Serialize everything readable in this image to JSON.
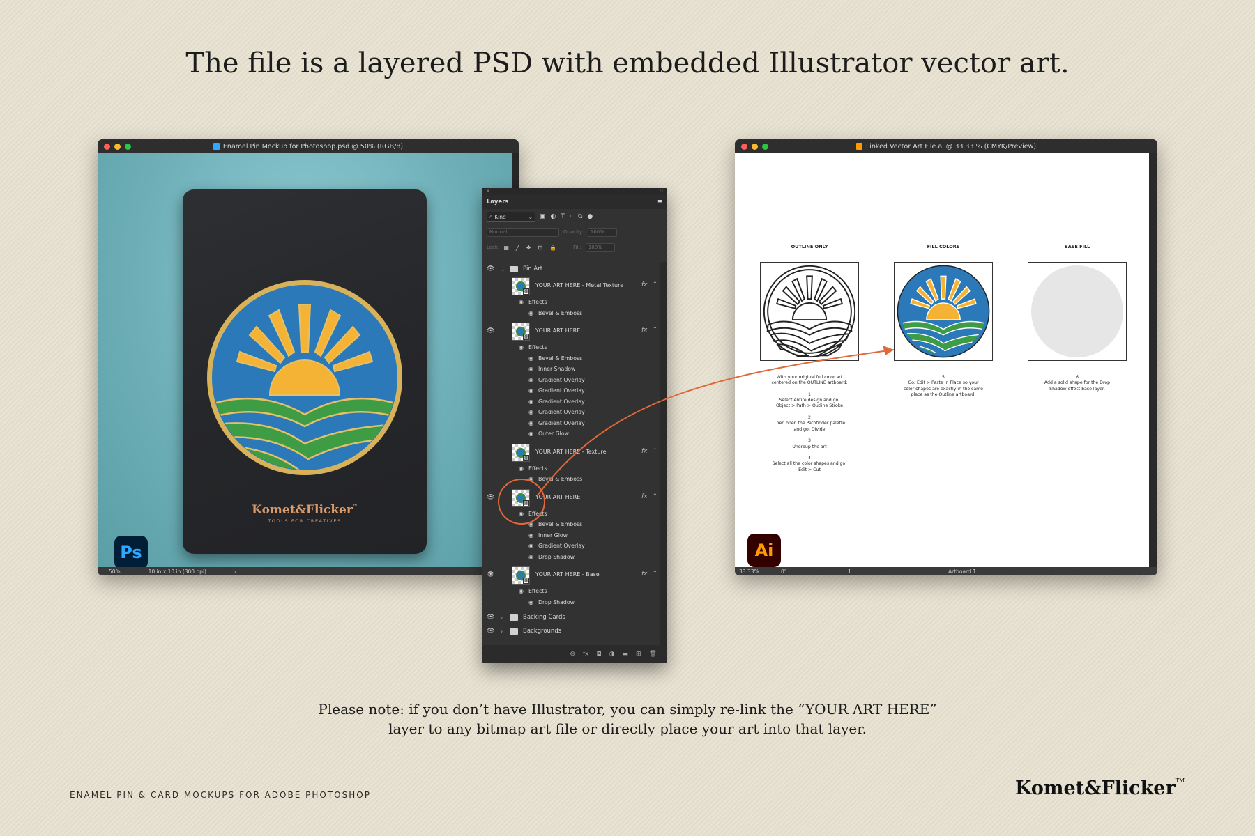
{
  "headline": "The file is a layered PSD with embedded Illustrator vector art.",
  "note": {
    "line1": "Please note: if you don’t have Illustrator, you can simply re-link the “YOUR ART HERE”",
    "line2": "layer to any bitmap art file or directly place your art into that layer."
  },
  "footer": {
    "left": "ENAMEL PIN & CARD MOCKUPS FOR ADOBE PHOTOSHOP",
    "brand": "Komet&Flicker",
    "brand_tm": "TM"
  },
  "colors": {
    "ps_blue": "#31a8ff",
    "ai_orange": "#ff9a00",
    "pin_blue": "#2b79b8",
    "pin_yellow": "#f5b335",
    "pin_green": "#3e9c45",
    "pin_gold": "#d8b25a",
    "annotation": "#e0683a"
  },
  "photoshop": {
    "title": "Enamel Pin Mockup for Photoshop.psd @ 50% (RGB/8)",
    "zoom": "50%",
    "doc_size": "10 in x 10 in (300 ppi)",
    "status_caret": "›",
    "badge": "Ps",
    "card": {
      "brand": "Komet&Flicker",
      "brand_tm": "™",
      "tagline": "TOOLS FOR CREATIVES"
    }
  },
  "layers_panel": {
    "close_glyph": "×",
    "collapse_glyph": "‹‹",
    "tab": "Layers",
    "menu_glyph": "≡",
    "kind_label": "Kind",
    "filter_icons": [
      "▣",
      "◐",
      "T",
      "⌗",
      "⧉",
      "●"
    ],
    "blend_mode": "Normal",
    "opacity_label": "Opacity:",
    "opacity_value": "100%",
    "lock_label": "Lock:",
    "lock_icons": [
      "▦",
      "╱",
      "✥",
      "⊡",
      "🔒"
    ],
    "fill_label": "Fill:",
    "fill_value": "100%",
    "eye_glyph": "👁",
    "effect_eye_glyph": "◉",
    "fx_label": "fx",
    "group_pin_art": "Pin Art",
    "layers": [
      {
        "name": "YOUR ART HERE - Metal Texture",
        "effects_label": "Effects",
        "effects": [
          "Bevel & Emboss"
        ],
        "visible": false
      },
      {
        "name": "YOUR ART HERE",
        "effects_label": "Effects",
        "effects": [
          "Bevel & Emboss",
          "Inner Shadow",
          "Gradient Overlay",
          "Gradient Overlay",
          "Gradient Overlay",
          "Gradient Overlay",
          "Gradient Overlay",
          "Outer Glow"
        ],
        "visible": true
      },
      {
        "name": "YOUR ART HERE - Texture",
        "effects_label": "Effects",
        "effects": [
          "Bevel & Emboss"
        ],
        "visible": false
      },
      {
        "name": "YOUR ART HERE",
        "effects_label": "Effects",
        "effects": [
          "Bevel & Emboss",
          "Inner Glow",
          "Gradient Overlay",
          "Drop Shadow"
        ],
        "visible": true
      },
      {
        "name": "YOUR ART HERE - Base",
        "effects_label": "Effects",
        "effects": [
          "Drop Shadow"
        ],
        "visible": true
      }
    ],
    "group_backing_cards": "Backing Cards",
    "group_backgrounds": "Backgrounds",
    "bottom_icons": [
      "⊖",
      "fx",
      "◘",
      "◑",
      "▬",
      "⊞",
      "🗑"
    ]
  },
  "illustrator": {
    "title": "Linked Vector Art File.ai @ 33.33 % (CMYK/Preview)",
    "badge": "Ai",
    "zoom": "33.33%",
    "rotation": "0°",
    "page_nav": "1",
    "artboard_name": "Artboard 1",
    "artboards": [
      {
        "label": "OUTLINE ONLY",
        "text": "With your original full color art\ncentered on the OUTLINE artboard:\n\n1\nSelect entire design and go:\nObject > Path > Outline Stroke\n\n2\nThen open the Pathfinder palette\nand go: Divide\n\n3\nUngroup the art\n\n4\nSelect all the color shapes and go:\nEdit > Cut"
      },
      {
        "label": "FILL COLORS",
        "text": "5\nGo: Edit > Paste in Place so your\ncolor shapes are exactly in the same\nplace as the Outline artboard."
      },
      {
        "label": "BASE FILL",
        "text": "6\nAdd a solid shape for the Drop\nShadow effect base layer."
      }
    ]
  }
}
